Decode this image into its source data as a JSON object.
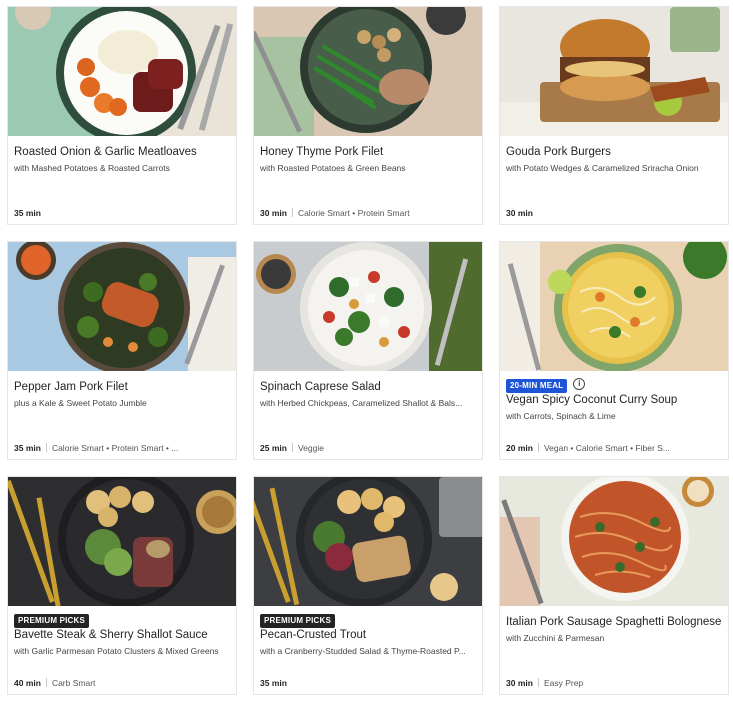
{
  "recipes": [
    {
      "title": "Roasted Onion & Garlic Meatloaves",
      "subtitle": "with Mashed Potatoes & Roasted Carrots",
      "time": "35 min",
      "tags": "",
      "badge": ""
    },
    {
      "title": "Honey Thyme Pork Filet",
      "subtitle": "with Roasted Potatoes & Green Beans",
      "time": "30 min",
      "tags": "Calorie Smart • Protein Smart",
      "badge": ""
    },
    {
      "title": "Gouda Pork Burgers",
      "subtitle": "with Potato Wedges & Caramelized Sriracha Onion",
      "time": "30 min",
      "tags": "",
      "badge": ""
    },
    {
      "title": "Pepper Jam Pork Filet",
      "subtitle": "plus a Kale & Sweet Potato Jumble",
      "time": "35 min",
      "tags": "Calorie Smart • Protein Smart • ...",
      "badge": ""
    },
    {
      "title": "Spinach Caprese Salad",
      "subtitle": "with Herbed Chickpeas, Caramelized Shallot & Bals...",
      "time": "25 min",
      "tags": "Veggie",
      "badge": ""
    },
    {
      "title": "Vegan Spicy Coconut Curry Soup",
      "subtitle": "with Carrots, Spinach & Lime",
      "time": "20 min",
      "tags": "Vegan • Calorie Smart • Fiber S...",
      "badge": "20-MIN MEAL",
      "info_icon": "info-icon"
    },
    {
      "title": "Bavette Steak & Sherry Shallot Sauce",
      "subtitle": "with Garlic Parmesan Potato Clusters & Mixed Greens",
      "time": "40 min",
      "tags": "Carb Smart",
      "badge": "PREMIUM PICKS"
    },
    {
      "title": "Pecan-Crusted Trout",
      "subtitle": "with a Cranberry-Studded Salad & Thyme-Roasted P...",
      "time": "35 min",
      "tags": "",
      "badge": "PREMIUM PICKS"
    },
    {
      "title": "Italian Pork Sausage Spaghetti Bolognese",
      "subtitle": "with Zucchini & Parmesan",
      "time": "30 min",
      "tags": "Easy Prep",
      "badge": ""
    }
  ],
  "colors": {
    "badge_dark": "#242424",
    "badge_blue": "#1d55d6"
  }
}
